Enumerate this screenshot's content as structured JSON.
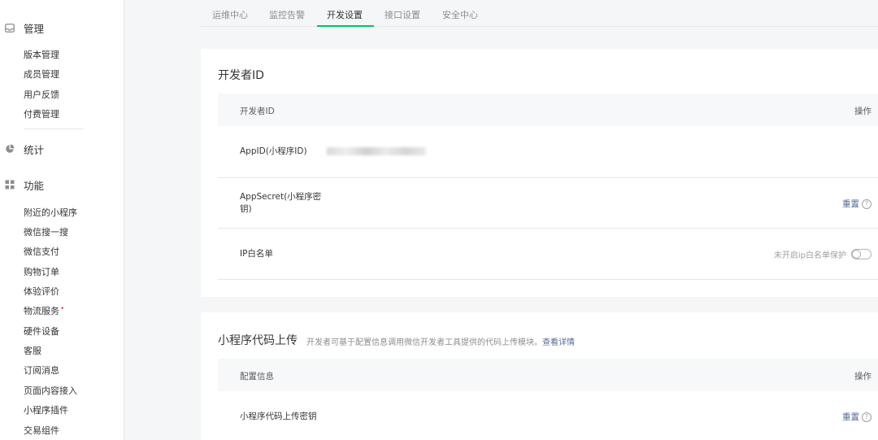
{
  "sidebar": {
    "groups": [
      {
        "label": "管理",
        "icon": "inbox-icon"
      },
      {
        "label": "统计",
        "icon": "pie-chart-icon"
      },
      {
        "label": "功能",
        "icon": "grid-icon"
      }
    ],
    "manage_items": [
      "版本管理",
      "成员管理",
      "用户反馈",
      "付费管理"
    ],
    "feature_items": [
      "附近的小程序",
      "微信搜一搜",
      "微信支付",
      "购物订单",
      "体验评价",
      "物流服务",
      "硬件设备",
      "客服",
      "订阅消息",
      "页面内容接入",
      "小程序插件",
      "交易组件"
    ],
    "new_dot": "•"
  },
  "tabs": [
    "运维中心",
    "监控告警",
    "开发设置",
    "接口设置",
    "安全中心"
  ],
  "active_tab": "开发设置",
  "developer_id_card": {
    "title": "开发者ID",
    "header_left": "开发者ID",
    "header_right": "操作",
    "rows": {
      "appid_label": "AppID(小程序ID)",
      "appsecret_label_line1": "AppSecret(小程序密",
      "appsecret_label_line2": "钥)",
      "appsecret_action": "重置",
      "ip_label": "IP白名单",
      "ip_status": "未开启ip白名单保护"
    },
    "help_icon": "?"
  },
  "upload_card": {
    "title": "小程序代码上传",
    "desc": "开发者可基于配置信息调用微信开发者工具提供的代码上传模块。",
    "desc_link": "查看详情",
    "header_left": "配置信息",
    "header_right": "操作",
    "row_label": "小程序代码上传密钥",
    "row_action": "重置"
  },
  "colors": {
    "accent_green": "#07c160",
    "link_blue": "#576b95",
    "danger_red": "#e64340"
  }
}
